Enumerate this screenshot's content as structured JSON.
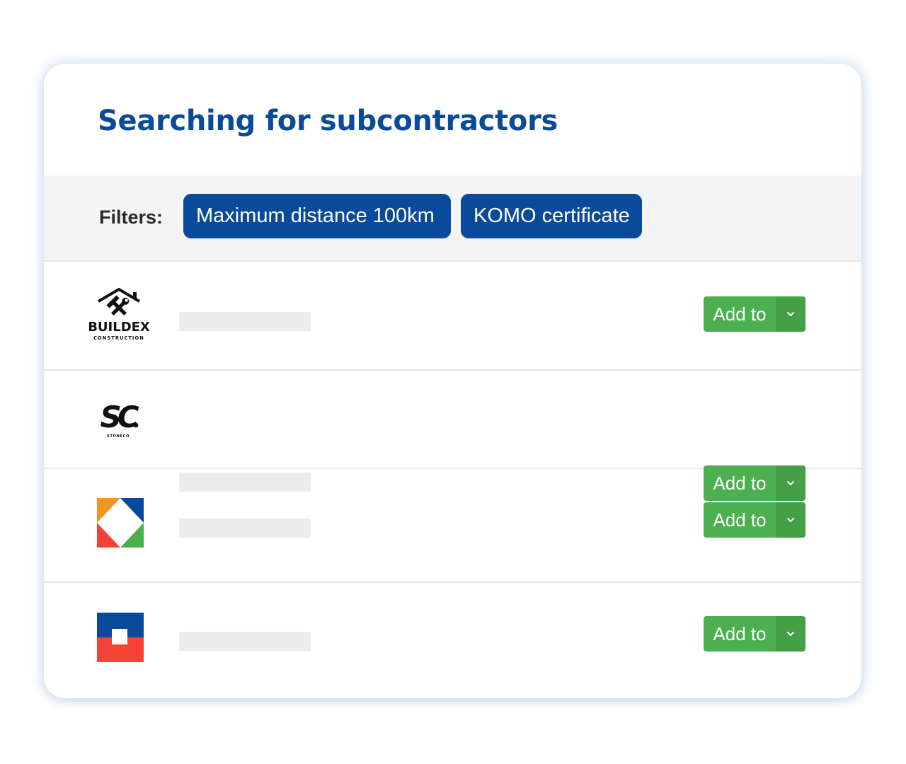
{
  "page": {
    "title": "Searching for subcontractors"
  },
  "filters": {
    "label": "Filters:",
    "chips": [
      {
        "label": "Maximum distance 100km"
      },
      {
        "label": "KOMO certificate"
      }
    ]
  },
  "results": [
    {
      "logo": "buildex-logo",
      "logo_text": "BUILDEX",
      "logo_subtext": "CONSTRUCTION",
      "action_label": "Add to"
    },
    {
      "logo": "stoneco-logo",
      "logo_text": "SC",
      "logo_subtext": "STONECO",
      "action_label": "Add to"
    },
    {
      "logo": "diamond-square-logo",
      "action_label": "Add to"
    },
    {
      "logo": "blue-red-block-logo",
      "action_label": "Add to"
    }
  ],
  "icons": {
    "dropdown": "chevron-down-icon"
  },
  "colors": {
    "brand_blue": "#0a4a9a",
    "action_green": "#4caf50",
    "action_green_dark": "#43a047",
    "logo_orange": "#f7941d",
    "logo_red": "#f44336",
    "logo_green": "#4caf50"
  }
}
